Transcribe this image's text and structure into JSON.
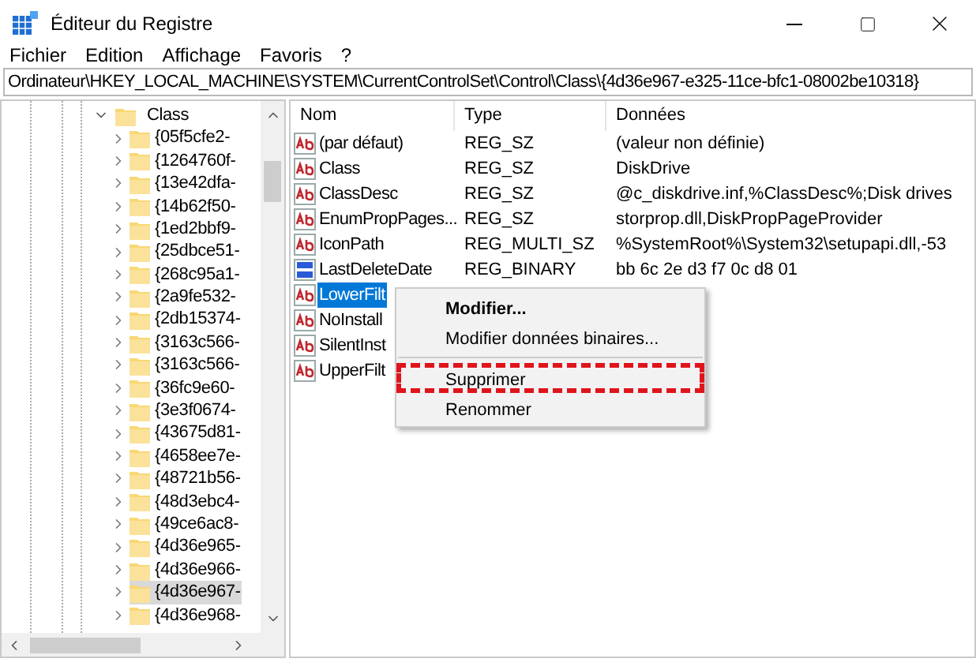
{
  "window": {
    "title": "Éditeur du Registre"
  },
  "menu": [
    "Fichier",
    "Edition",
    "Affichage",
    "Favoris",
    "?"
  ],
  "address": "Ordinateur\\HKEY_LOCAL_MACHINE\\SYSTEM\\CurrentControlSet\\Control\\Class\\{4d36e967-e325-11ce-bfc1-08002be10318}",
  "tree": {
    "label": "Class",
    "expanded": true,
    "children": [
      {
        "label": "{05f5cfe2-",
        "selected": false
      },
      {
        "label": "{1264760f-",
        "selected": false
      },
      {
        "label": "{13e42dfa-",
        "selected": false
      },
      {
        "label": "{14b62f50-",
        "selected": false
      },
      {
        "label": "{1ed2bbf9-",
        "selected": false
      },
      {
        "label": "{25dbce51-",
        "selected": false
      },
      {
        "label": "{268c95a1-",
        "selected": false
      },
      {
        "label": "{2a9fe532-",
        "selected": false
      },
      {
        "label": "{2db15374-",
        "selected": false
      },
      {
        "label": "{3163c566-",
        "selected": false
      },
      {
        "label": "{3163c566-",
        "selected": false
      },
      {
        "label": "{36fc9e60-",
        "selected": false
      },
      {
        "label": "{3e3f0674-",
        "selected": false
      },
      {
        "label": "{43675d81-",
        "selected": false
      },
      {
        "label": "{4658ee7e-",
        "selected": false
      },
      {
        "label": "{48721b56-",
        "selected": false
      },
      {
        "label": "{48d3ebc4-",
        "selected": false
      },
      {
        "label": "{49ce6ac8-",
        "selected": false
      },
      {
        "label": "{4d36e965-",
        "selected": false
      },
      {
        "label": "{4d36e966-",
        "selected": false
      },
      {
        "label": "{4d36e967-",
        "selected": true
      },
      {
        "label": "{4d36e968-",
        "selected": false
      }
    ]
  },
  "table": {
    "columns": [
      "Nom",
      "Type",
      "Données"
    ],
    "rows": [
      {
        "kind": "string",
        "name": "(par défaut)",
        "type": "REG_SZ",
        "data": "(valeur non définie)",
        "selected": false
      },
      {
        "kind": "string",
        "name": "Class",
        "type": "REG_SZ",
        "data": "DiskDrive",
        "selected": false
      },
      {
        "kind": "string",
        "name": "ClassDesc",
        "type": "REG_SZ",
        "data": "@c_diskdrive.inf,%ClassDesc%;Disk drives",
        "selected": false
      },
      {
        "kind": "string",
        "name": "EnumPropPages...",
        "type": "REG_SZ",
        "data": "storprop.dll,DiskPropPageProvider",
        "selected": false
      },
      {
        "kind": "string",
        "name": "IconPath",
        "type": "REG_MULTI_SZ",
        "data": "%SystemRoot%\\System32\\setupapi.dll,-53",
        "selected": false
      },
      {
        "kind": "binary",
        "name": "LastDeleteDate",
        "type": "REG_BINARY",
        "data": "bb 6c 2e d3 f7 0c d8 01",
        "selected": false
      },
      {
        "kind": "string",
        "name": "LowerFilt",
        "selected": true
      },
      {
        "kind": "string",
        "name": "NoInstall",
        "selected": false
      },
      {
        "kind": "string",
        "name": "SilentInst",
        "selected": false
      },
      {
        "kind": "string",
        "name": "UpperFilt",
        "selected": false
      }
    ]
  },
  "context_menu": [
    {
      "kind": "item",
      "label": "Modifier...",
      "bold": true,
      "highlighted": false
    },
    {
      "kind": "item",
      "label": "Modifier données binaires...",
      "bold": false,
      "highlighted": false
    },
    {
      "kind": "separator"
    },
    {
      "kind": "item",
      "label": "Supprimer",
      "bold": false,
      "highlighted": true
    },
    {
      "kind": "item",
      "label": "Renommer",
      "bold": false,
      "highlighted": false
    }
  ]
}
